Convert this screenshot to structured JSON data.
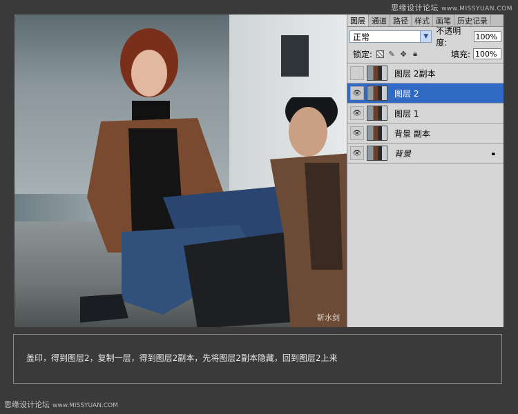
{
  "watermark": {
    "text": "思缘设计论坛",
    "url": "www.MISSYUAN.COM"
  },
  "photo": {
    "signature": "靳水剑"
  },
  "panel": {
    "tabs": [
      {
        "label": "图层",
        "active": true
      },
      {
        "label": "通道",
        "active": false
      },
      {
        "label": "路径",
        "active": false
      },
      {
        "label": "样式",
        "active": false
      },
      {
        "label": "画笔",
        "active": false
      },
      {
        "label": "历史记录",
        "active": false
      }
    ],
    "blend_mode": "正常",
    "opacity_label": "不透明度:",
    "opacity_value": "100%",
    "lock_label": "锁定:",
    "fill_label": "填充:",
    "fill_value": "100%",
    "layers": [
      {
        "name": "图层 2副本",
        "visible": false,
        "selected": false,
        "italic": false,
        "locked": false
      },
      {
        "name": "图层 2",
        "visible": true,
        "selected": true,
        "italic": false,
        "locked": false
      },
      {
        "name": "图层 1",
        "visible": true,
        "selected": false,
        "italic": false,
        "locked": false
      },
      {
        "name": "背景 副本",
        "visible": true,
        "selected": false,
        "italic": false,
        "locked": false
      },
      {
        "name": "背景",
        "visible": true,
        "selected": false,
        "italic": true,
        "locked": true
      }
    ]
  },
  "caption": "盖印，得到图层2，复制一层，得到图层2副本，先将图层2副本隐藏，回到图层2上来",
  "colors": {
    "selection": "#316ac5",
    "background": "#3a3a3a"
  }
}
